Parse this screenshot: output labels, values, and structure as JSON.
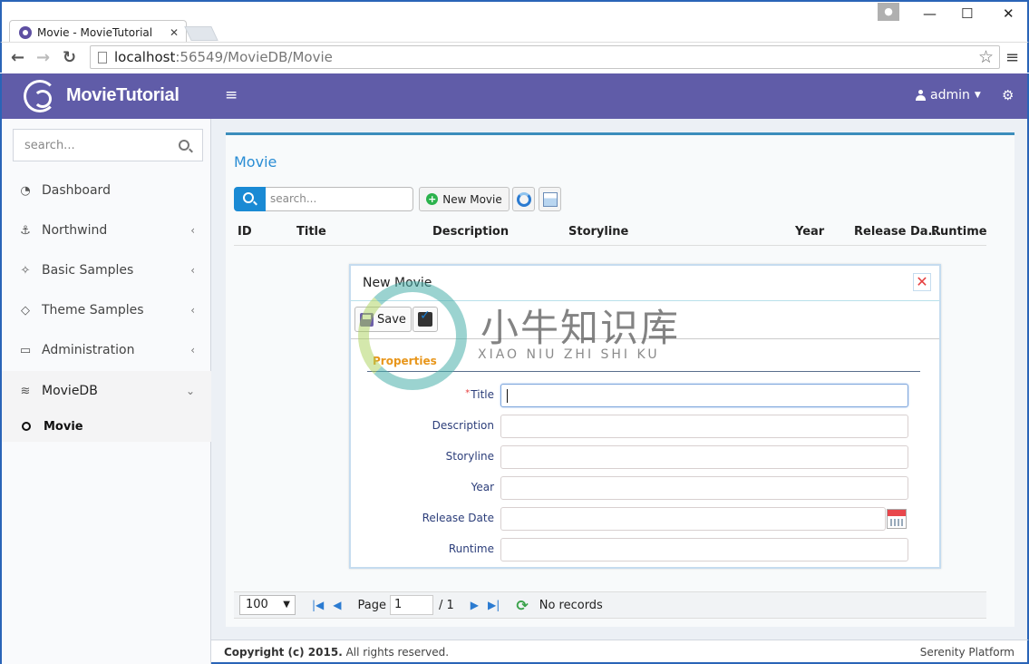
{
  "browser": {
    "tab_title": "Movie - MovieTutorial",
    "tab_close": "✕",
    "url_host": "localhost",
    "url_path": ":56549/MovieDB/Movie",
    "back": "←",
    "forward": "→",
    "reload": "↻",
    "star": "☆",
    "menu": "≡",
    "win_minimize": "—",
    "win_maximize": "☐",
    "win_close": "✕"
  },
  "header": {
    "app_name": "MovieTutorial",
    "hamburger": "≡",
    "user": "admin",
    "caret": "▼",
    "gears": "⚙"
  },
  "sidebar": {
    "search_placeholder": "search...",
    "items": [
      {
        "label": "Dashboard",
        "icon": "dashboard-icon",
        "glyph": "◔",
        "chevron": ""
      },
      {
        "label": "Northwind",
        "icon": "anchor-icon",
        "glyph": "⚓",
        "chevron": "‹"
      },
      {
        "label": "Basic Samples",
        "icon": "magic-icon",
        "glyph": "✧",
        "chevron": "‹"
      },
      {
        "label": "Theme Samples",
        "icon": "diamond-icon",
        "glyph": "◇",
        "chevron": "‹"
      },
      {
        "label": "Administration",
        "icon": "desktop-icon",
        "glyph": "▭",
        "chevron": "‹"
      },
      {
        "label": "MovieDB",
        "icon": "layers-icon",
        "glyph": "≋",
        "chevron": "⌄"
      }
    ],
    "sub_item": "Movie"
  },
  "main": {
    "title": "Movie",
    "search_placeholder": "search...",
    "new_button": "New Movie",
    "plus": "+",
    "columns": [
      "ID",
      "Title",
      "Description",
      "Storyline",
      "Year",
      "Release Da...",
      "Runtime"
    ]
  },
  "dialog": {
    "title": "New Movie",
    "close": "✕",
    "save_label": "Save",
    "tab": "Properties",
    "required_mark": "*",
    "fields": [
      {
        "label": "Title",
        "value": ""
      },
      {
        "label": "Description",
        "value": ""
      },
      {
        "label": "Storyline",
        "value": ""
      },
      {
        "label": "Year",
        "value": ""
      },
      {
        "label": "Release Date",
        "value": ""
      },
      {
        "label": "Runtime",
        "value": ""
      }
    ]
  },
  "watermark": {
    "cn": "小牛知识库",
    "en": "XIAO NIU ZHI SHI KU"
  },
  "pager": {
    "page_size": "100",
    "dd": "▼",
    "first": "|◀",
    "prev": "◀",
    "page_label": "Page",
    "page_value": "1",
    "of_total": "/ 1",
    "next": "▶",
    "last": "▶|",
    "reload": "⟳",
    "status": "No records"
  },
  "footer": {
    "copyright_bold": "Copyright (c) 2015.",
    "copyright_rest": " All rights reserved.",
    "platform": "Serenity Platform"
  }
}
